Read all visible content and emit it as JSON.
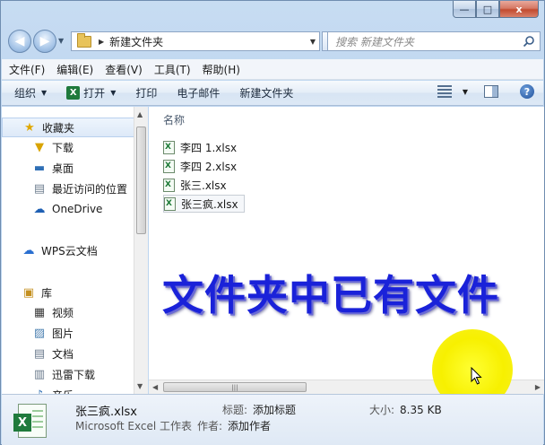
{
  "window": {
    "caption": {
      "minimize": "—",
      "maximize": "□",
      "close": "x"
    }
  },
  "address": {
    "path": "新建文件夹",
    "search_placeholder": "搜索 新建文件夹"
  },
  "menu": [
    "文件(F)",
    "编辑(E)",
    "查看(V)",
    "工具(T)",
    "帮助(H)"
  ],
  "toolbar": {
    "organize": "组织",
    "open": "打开",
    "print": "打印",
    "email": "电子邮件",
    "new_folder": "新建文件夹"
  },
  "navpane": {
    "favorites": "收藏夹",
    "downloads": "下载",
    "desktop": "桌面",
    "recent": "最近访问的位置",
    "onedrive": "OneDrive",
    "wps": "WPS云文档",
    "library": "库",
    "videos": "视频",
    "pictures": "图片",
    "documents": "文档",
    "xunlei": "迅雷下载",
    "music": "音乐"
  },
  "content": {
    "column_name": "名称",
    "files": [
      "李四 1.xlsx",
      "李四 2.xlsx",
      "张三.xlsx",
      "张三疯.xlsx"
    ],
    "overlay": "文件夹中已有文件"
  },
  "details": {
    "filename": "张三疯.xlsx",
    "filetype": "Microsoft Excel 工作表",
    "title_label": "标题:",
    "title_value": "添加标题",
    "author_label": "作者:",
    "author_value": "添加作者",
    "size_label": "大小:",
    "size_value": "8.35 KB"
  },
  "colors": {
    "overlay_text": "#1a22d9",
    "cursor_highlight": "#f7f000",
    "excel_green": "#1f7a3c"
  }
}
